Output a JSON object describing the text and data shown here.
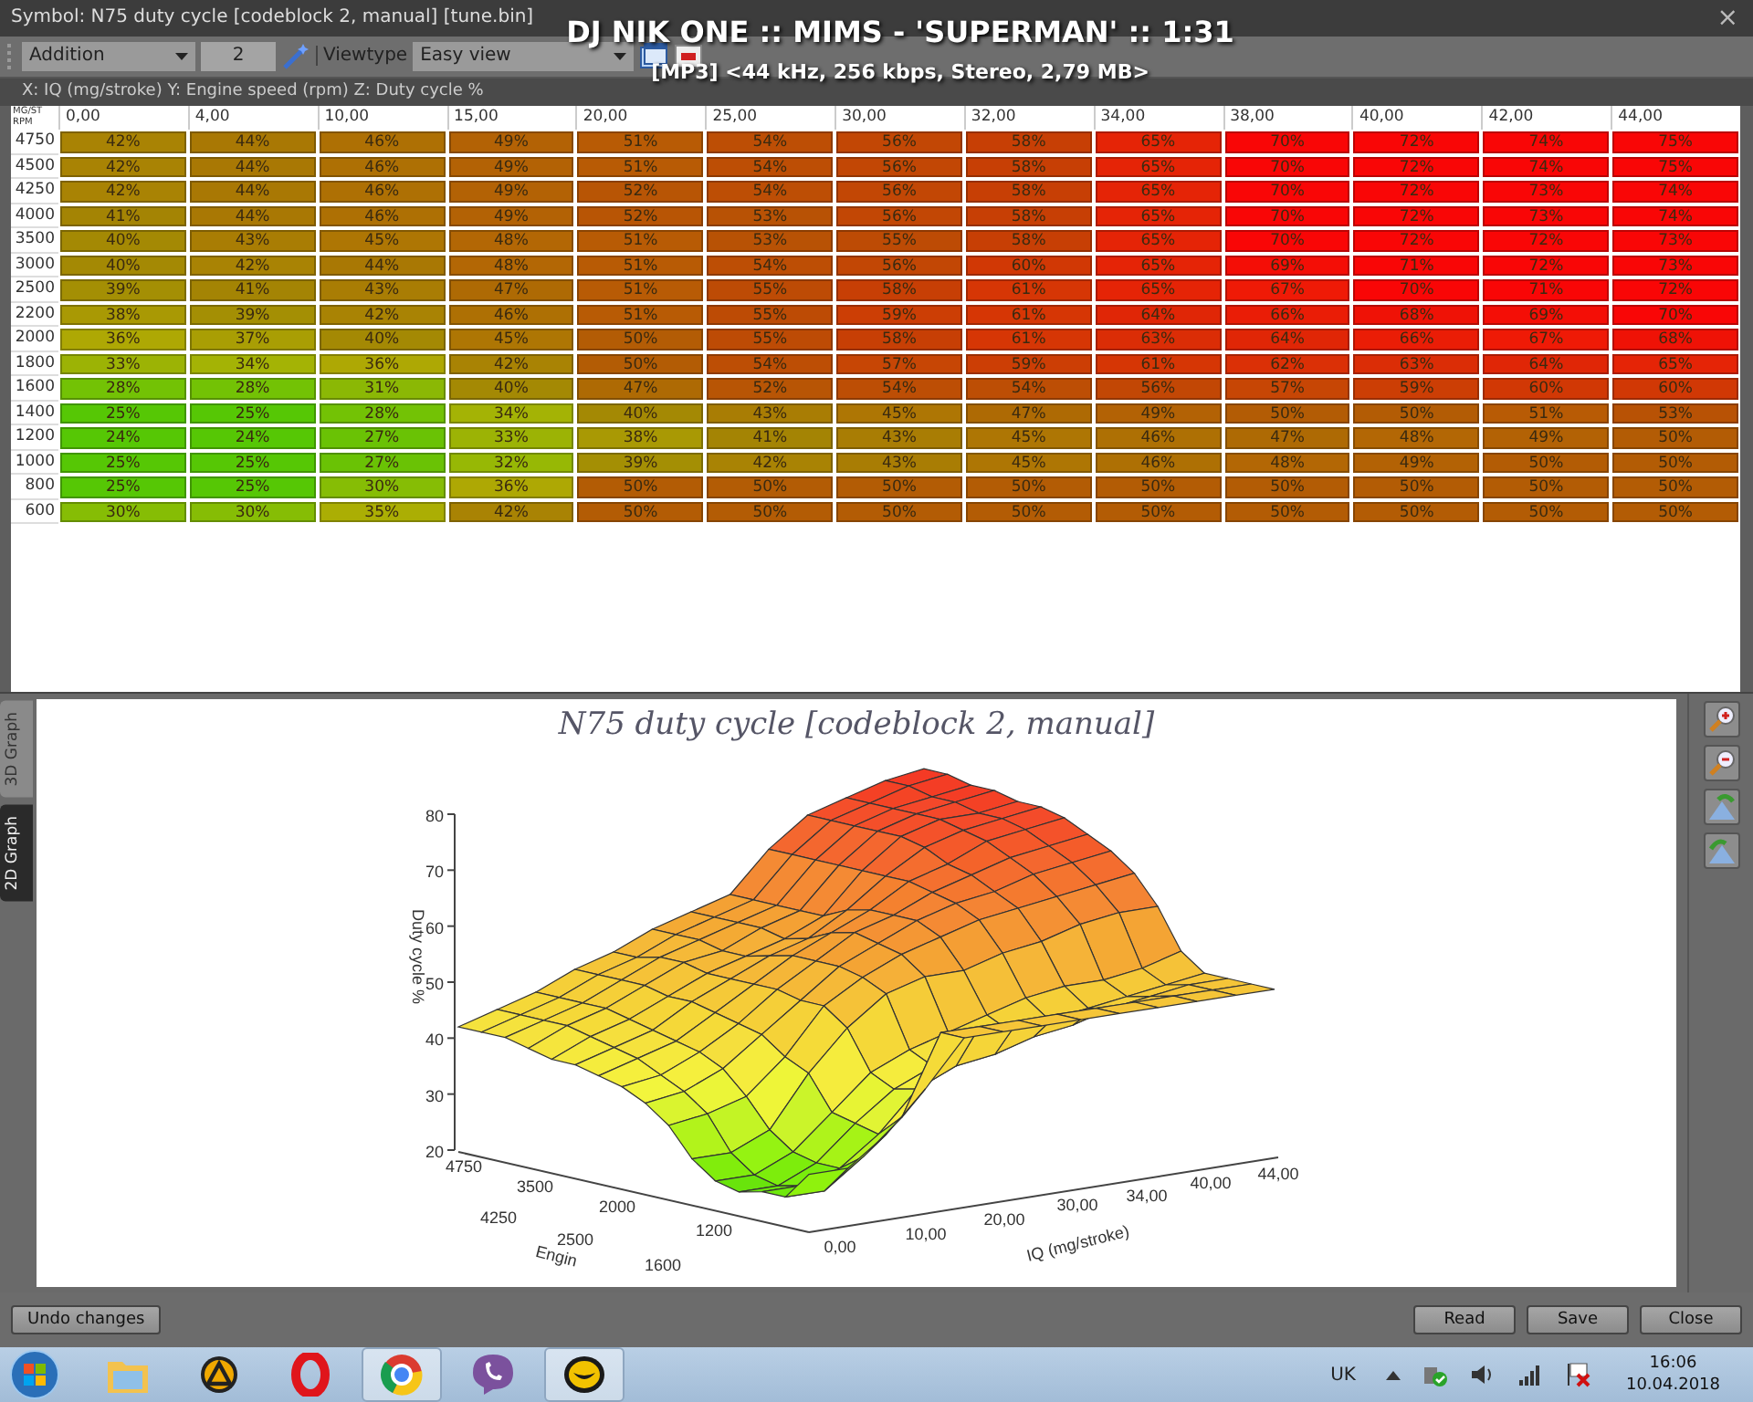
{
  "window": {
    "title": "Symbol: N75 duty cycle [codeblock 2, manual] [tune.bin]",
    "close": "×"
  },
  "media_overlay": {
    "track": "DJ NIK ONE :: MIMS - 'SUPERMAN' :: 1:31",
    "info": "[MP3] <44 kHz, 256 kbps, Stereo, 2,79 MB>"
  },
  "toolbar": {
    "mode": "Addition",
    "step": "2",
    "viewtype_label": "Viewtype",
    "viewtype": "Easy view"
  },
  "axis_info": "X: IQ (mg/stroke) Y: Engine speed (rpm) Z: Duty cycle %",
  "table": {
    "corner_top": "MG/ST",
    "corner_bottom": "RPM",
    "columns": [
      "0,00",
      "4,00",
      "10,00",
      "15,00",
      "20,00",
      "25,00",
      "30,00",
      "32,00",
      "34,00",
      "38,00",
      "40,00",
      "42,00",
      "44,00"
    ],
    "rows": [
      {
        "rpm": "4750",
        "cells": [
          "42%",
          "44%",
          "46%",
          "49%",
          "51%",
          "54%",
          "56%",
          "58%",
          "65%",
          "70%",
          "72%",
          "74%",
          "75%"
        ]
      },
      {
        "rpm": "4500",
        "cells": [
          "42%",
          "44%",
          "46%",
          "49%",
          "51%",
          "54%",
          "56%",
          "58%",
          "65%",
          "70%",
          "72%",
          "74%",
          "75%"
        ]
      },
      {
        "rpm": "4250",
        "cells": [
          "42%",
          "44%",
          "46%",
          "49%",
          "52%",
          "54%",
          "56%",
          "58%",
          "65%",
          "70%",
          "72%",
          "73%",
          "74%"
        ]
      },
      {
        "rpm": "4000",
        "cells": [
          "41%",
          "44%",
          "46%",
          "49%",
          "52%",
          "53%",
          "56%",
          "58%",
          "65%",
          "70%",
          "72%",
          "73%",
          "74%"
        ]
      },
      {
        "rpm": "3500",
        "cells": [
          "40%",
          "43%",
          "45%",
          "48%",
          "51%",
          "53%",
          "55%",
          "58%",
          "65%",
          "70%",
          "72%",
          "72%",
          "73%"
        ]
      },
      {
        "rpm": "3000",
        "cells": [
          "40%",
          "42%",
          "44%",
          "48%",
          "51%",
          "54%",
          "56%",
          "60%",
          "65%",
          "69%",
          "71%",
          "72%",
          "73%"
        ]
      },
      {
        "rpm": "2500",
        "cells": [
          "39%",
          "41%",
          "43%",
          "47%",
          "51%",
          "55%",
          "58%",
          "61%",
          "65%",
          "67%",
          "70%",
          "71%",
          "72%"
        ]
      },
      {
        "rpm": "2200",
        "cells": [
          "38%",
          "39%",
          "42%",
          "46%",
          "51%",
          "55%",
          "59%",
          "61%",
          "64%",
          "66%",
          "68%",
          "69%",
          "70%"
        ]
      },
      {
        "rpm": "2000",
        "cells": [
          "36%",
          "37%",
          "40%",
          "45%",
          "50%",
          "55%",
          "58%",
          "61%",
          "63%",
          "64%",
          "66%",
          "67%",
          "68%"
        ]
      },
      {
        "rpm": "1800",
        "cells": [
          "33%",
          "34%",
          "36%",
          "42%",
          "50%",
          "54%",
          "57%",
          "59%",
          "61%",
          "62%",
          "63%",
          "64%",
          "65%"
        ]
      },
      {
        "rpm": "1600",
        "cells": [
          "28%",
          "28%",
          "31%",
          "40%",
          "47%",
          "52%",
          "54%",
          "54%",
          "56%",
          "57%",
          "59%",
          "60%",
          "60%"
        ]
      },
      {
        "rpm": "1400",
        "cells": [
          "25%",
          "25%",
          "28%",
          "34%",
          "40%",
          "43%",
          "45%",
          "47%",
          "49%",
          "50%",
          "50%",
          "51%",
          "53%"
        ]
      },
      {
        "rpm": "1200",
        "cells": [
          "24%",
          "24%",
          "27%",
          "33%",
          "38%",
          "41%",
          "43%",
          "45%",
          "46%",
          "47%",
          "48%",
          "49%",
          "50%"
        ]
      },
      {
        "rpm": "1000",
        "cells": [
          "25%",
          "25%",
          "27%",
          "32%",
          "39%",
          "42%",
          "43%",
          "45%",
          "46%",
          "48%",
          "49%",
          "50%",
          "50%"
        ]
      },
      {
        "rpm": "800",
        "cells": [
          "25%",
          "25%",
          "30%",
          "36%",
          "50%",
          "50%",
          "50%",
          "50%",
          "50%",
          "50%",
          "50%",
          "50%",
          "50%"
        ]
      },
      {
        "rpm": "600",
        "cells": [
          "30%",
          "30%",
          "35%",
          "42%",
          "50%",
          "50%",
          "50%",
          "50%",
          "50%",
          "50%",
          "50%",
          "50%",
          "50%"
        ]
      }
    ]
  },
  "graph_tabs": [
    {
      "label": "3D Graph",
      "selected": false
    },
    {
      "label": "2D Graph",
      "selected": true
    }
  ],
  "graph": {
    "title": "N75 duty cycle [codeblock 2, manual]",
    "z_label": "Duty cycle %",
    "x_label": "IQ (mg/stroke)",
    "y_label": "Engin",
    "z_ticks": [
      "80",
      "70",
      "60",
      "50",
      "40",
      "30",
      "20"
    ],
    "y_ticks_front": [
      "4750",
      "3500",
      "2000",
      "1200"
    ],
    "y_ticks_back": [
      "4250",
      "2500",
      "1600"
    ],
    "x_ticks": [
      "0,00",
      "10,00",
      "20,00",
      "30,00",
      "34,00",
      "40,00",
      "44,00"
    ]
  },
  "buttons": {
    "undo": "Undo changes",
    "actions": [
      "Read",
      "Save",
      "Close"
    ]
  },
  "taskbar": {
    "apps": [
      {
        "kind": "folder",
        "active": false
      },
      {
        "kind": "triangle",
        "active": false
      },
      {
        "kind": "ring",
        "active": false
      },
      {
        "kind": "wheel",
        "active": true
      },
      {
        "kind": "phone",
        "active": false
      },
      {
        "kind": "smile",
        "active": true
      }
    ],
    "language": "UK",
    "time": "16:06",
    "date": "10.04.2018"
  }
}
